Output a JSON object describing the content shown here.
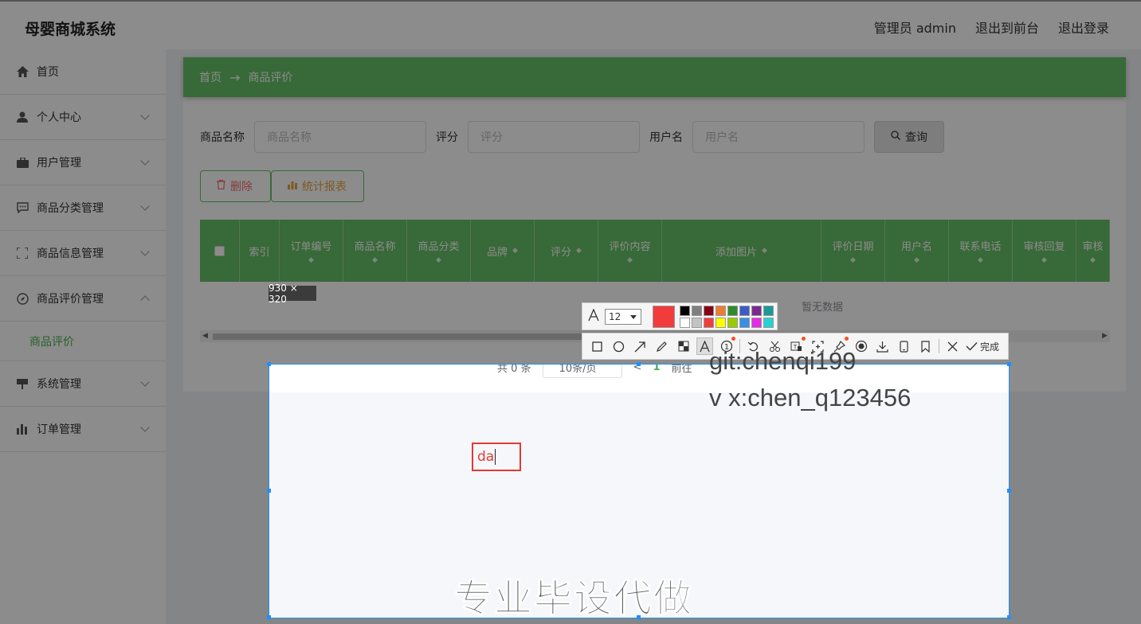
{
  "app": {
    "title": "母婴商城系统"
  },
  "header": {
    "user_label": "管理员 admin",
    "to_front": "退出到前台",
    "logout": "退出登录"
  },
  "sidebar": {
    "items": [
      {
        "label": "首页",
        "icon": "home-icon"
      },
      {
        "label": "个人中心",
        "icon": "user-icon"
      },
      {
        "label": "用户管理",
        "icon": "briefcase-icon"
      },
      {
        "label": "商品分类管理",
        "icon": "chat-icon"
      },
      {
        "label": "商品信息管理",
        "icon": "frame-icon"
      },
      {
        "label": "商品评价管理",
        "icon": "compass-icon"
      },
      {
        "label": "系统管理",
        "icon": "sign-icon"
      },
      {
        "label": "订单管理",
        "icon": "bar-chart-icon"
      }
    ],
    "sub_item": "商品评价"
  },
  "breadcrumb": {
    "home": "首页",
    "arrow": "→",
    "current": "商品评价"
  },
  "search": {
    "name_label": "商品名称",
    "name_placeholder": "商品名称",
    "score_label": "评分",
    "score_placeholder": "评分",
    "user_label": "用户名",
    "user_placeholder": "用户名",
    "query_button": "查询"
  },
  "actions": {
    "delete": "删除",
    "stats": "统计报表"
  },
  "table": {
    "columns": [
      "索引",
      "订单编号",
      "商品名称",
      "商品分类",
      "品牌",
      "评分",
      "评价内容",
      "添加图片",
      "评价日期",
      "用户名",
      "联系电话",
      "审核回复",
      "审核"
    ],
    "empty_text": "暂无数据"
  },
  "pager": {
    "total": "共 0 条",
    "page_size": "10条/页",
    "prev": "<",
    "page": "1",
    "jump": "前往"
  },
  "screenshot_tool": {
    "size_label": "930 × 320",
    "font_size": "12",
    "current_color": "#f23c3c",
    "palette": [
      "#000000",
      "#7f7f7f",
      "#880015",
      "#ed7d31",
      "#2e8b2e",
      "#3b5cc8",
      "#7b2b8f",
      "#1a9a9a",
      "#ffffff",
      "#c3c3c3",
      "#f23c3c",
      "#ffff00",
      "#99cc00",
      "#3a8ee6",
      "#e52ce5",
      "#22d3d3"
    ],
    "typed_text": "da",
    "done_label": "完成"
  },
  "watermark": {
    "line1": "git:chenqi199",
    "line2": "v x:chen_q123456",
    "banner": "专业毕设代做"
  },
  "colors": {
    "primary": "#67c067",
    "active": "#4caf50",
    "selection": "#1e90ff"
  }
}
